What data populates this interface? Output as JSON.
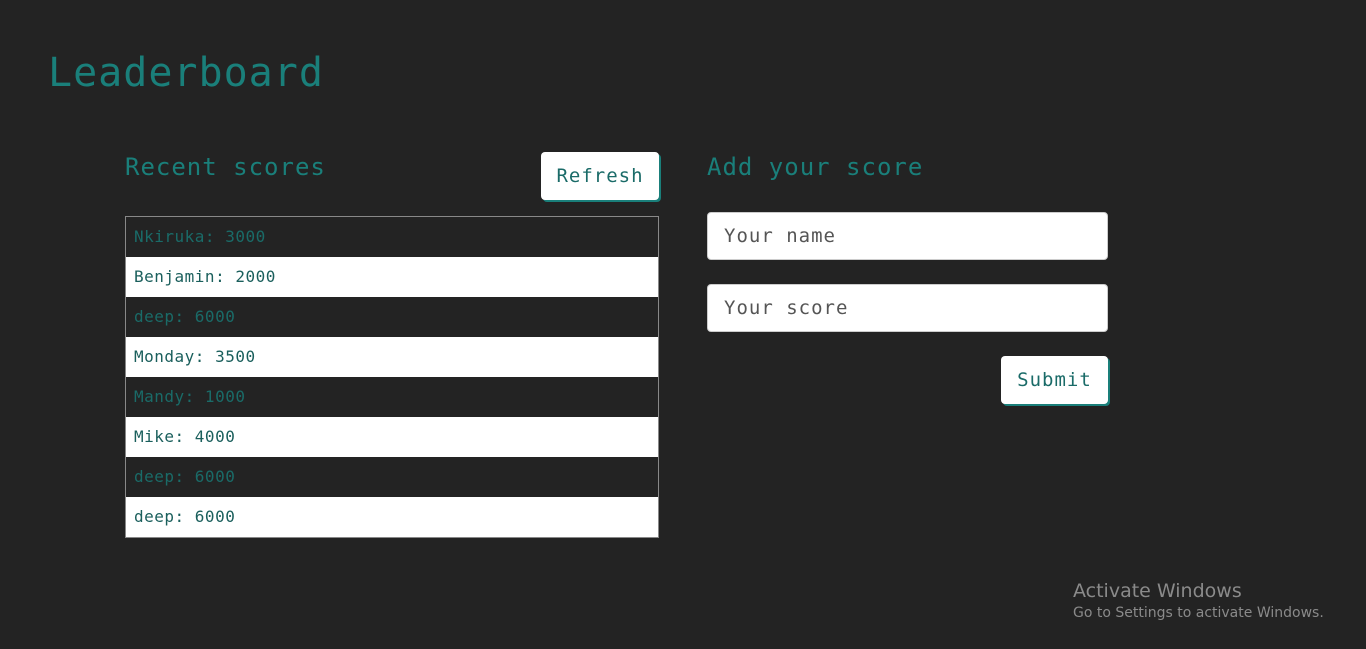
{
  "page": {
    "title": "Leaderboard"
  },
  "recent": {
    "heading": "Recent scores",
    "refresh_label": "Refresh",
    "scores": [
      "Nkiruka: 3000",
      "Benjamin: 2000",
      "deep: 6000",
      "Monday: 3500",
      "Mandy: 1000",
      "Mike: 4000",
      "deep: 6000",
      "deep: 6000"
    ]
  },
  "add": {
    "heading": "Add your score",
    "name_placeholder": "Your name",
    "score_placeholder": "Your score",
    "submit_label": "Submit"
  },
  "watermark": {
    "title": "Activate Windows",
    "subtitle": "Go to Settings to activate Windows."
  },
  "colors": {
    "background": "#232323",
    "accent": "#1a7f7a",
    "row_light": "#ffffff",
    "row_dark": "#232323"
  }
}
